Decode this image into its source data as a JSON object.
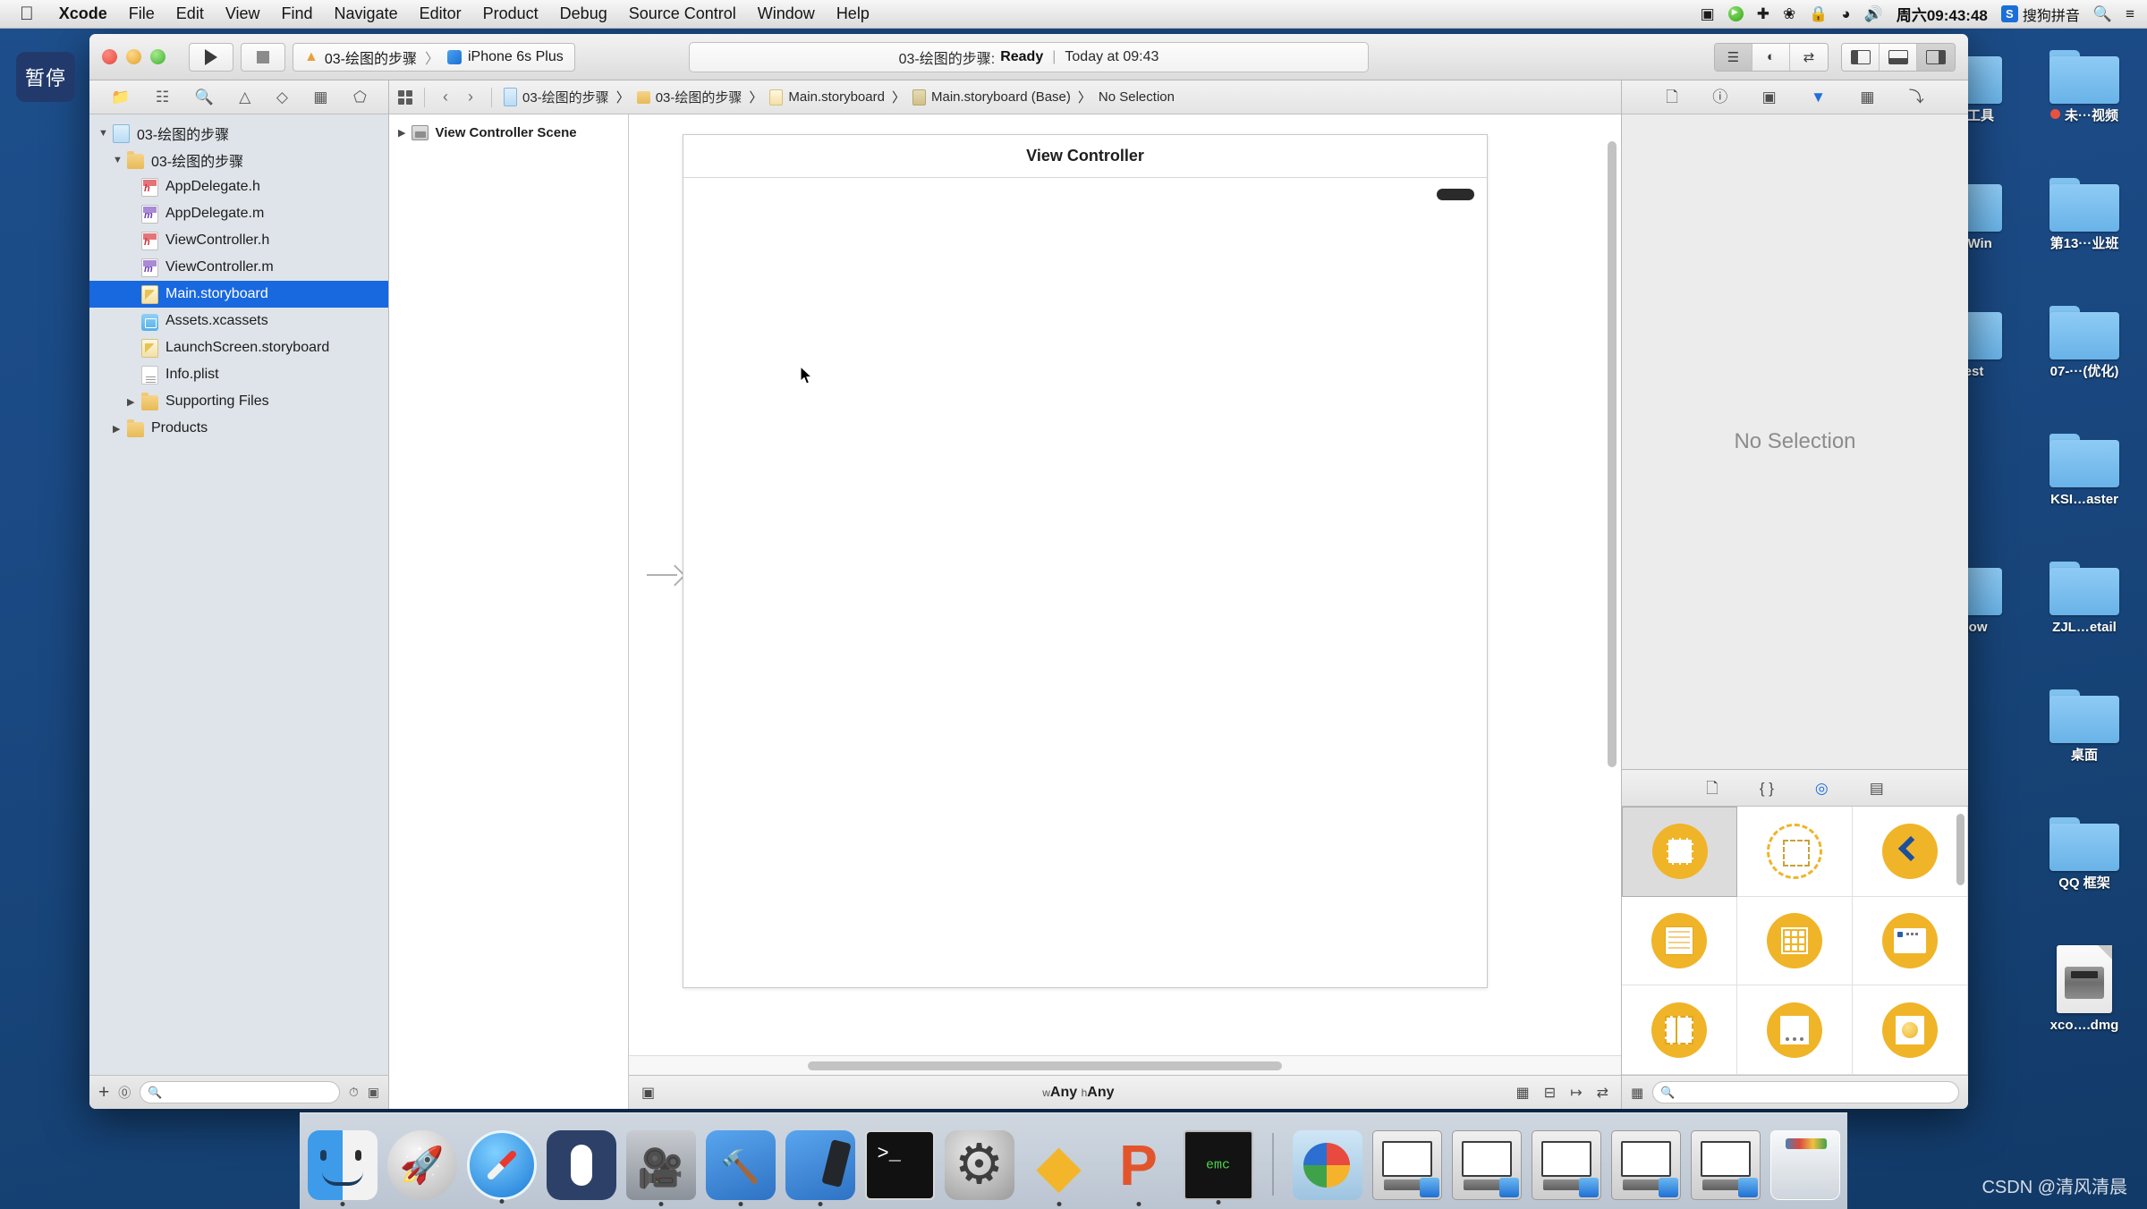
{
  "menubar": {
    "apple_icon": "apple-logo",
    "items": [
      {
        "label": "Xcode",
        "bold": true
      },
      {
        "label": "File",
        "bold": false
      },
      {
        "label": "Edit",
        "bold": false
      },
      {
        "label": "View",
        "bold": false
      },
      {
        "label": "Find",
        "bold": false
      },
      {
        "label": "Navigate",
        "bold": false
      },
      {
        "label": "Editor",
        "bold": false
      },
      {
        "label": "Product",
        "bold": false
      },
      {
        "label": "Debug",
        "bold": false
      },
      {
        "label": "Source Control",
        "bold": false
      },
      {
        "label": "Window",
        "bold": false
      },
      {
        "label": "Help",
        "bold": false
      }
    ],
    "status_icons": [
      "screen-record-icon",
      "play-green-icon",
      "airplane-icon",
      "bluetooth-icon",
      "lock-icon",
      "wifi-icon",
      "volume-icon"
    ],
    "clock": "周六09:43:48",
    "ime_badge": "S",
    "ime_label": "搜狗拼音",
    "search_icon": "search-icon",
    "control_center_icon": "list-icon"
  },
  "pause_badge": {
    "label": "暂停"
  },
  "toolbar": {
    "run_button": "run-button",
    "stop_button": "stop-button",
    "scheme_name": "03-绘图的步骤",
    "scheme_separator": "〉",
    "destination": "iPhone 6s Plus",
    "status_project": "03-绘图的步骤:",
    "status_state": "Ready",
    "status_divider": "|",
    "status_time": "Today at 09:43",
    "editor_segments": [
      "standard-editor-icon",
      "assistant-editor-icon",
      "version-editor-icon"
    ],
    "panel_toggles": [
      "navigator-toggle",
      "debug-toggle",
      "utilities-toggle"
    ]
  },
  "navigator": {
    "tabs": [
      {
        "name": "project-navigator",
        "icon": "folder-icon",
        "selected": true
      },
      {
        "name": "source-control-navigator",
        "icon": "branch-icon",
        "selected": false
      },
      {
        "name": "find-navigator",
        "icon": "search-icon",
        "selected": false
      },
      {
        "name": "issue-navigator",
        "icon": "warning-icon",
        "selected": false
      },
      {
        "name": "test-navigator",
        "icon": "diamond-icon",
        "selected": false
      },
      {
        "name": "debug-navigator",
        "icon": "debug-icon",
        "selected": false
      },
      {
        "name": "breakpoint-navigator",
        "icon": "tag-icon",
        "selected": false
      }
    ],
    "items": [
      {
        "label": "03-绘图的步骤",
        "indent": 0,
        "twisty": "▼",
        "icon": "project-icon",
        "selected": false
      },
      {
        "label": "03-绘图的步骤",
        "indent": 1,
        "twisty": "▼",
        "icon": "folder-icon",
        "selected": false
      },
      {
        "label": "AppDelegate.h",
        "indent": 2,
        "twisty": "",
        "icon": "header-file-icon",
        "selected": false
      },
      {
        "label": "AppDelegate.m",
        "indent": 2,
        "twisty": "",
        "icon": "objc-file-icon",
        "selected": false
      },
      {
        "label": "ViewController.h",
        "indent": 2,
        "twisty": "",
        "icon": "header-file-icon",
        "selected": false
      },
      {
        "label": "ViewController.m",
        "indent": 2,
        "twisty": "",
        "icon": "objc-file-icon",
        "selected": false
      },
      {
        "label": "Main.storyboard",
        "indent": 2,
        "twisty": "",
        "icon": "storyboard-icon",
        "selected": true
      },
      {
        "label": "Assets.xcassets",
        "indent": 2,
        "twisty": "",
        "icon": "xcassets-icon",
        "selected": false
      },
      {
        "label": "LaunchScreen.storyboard",
        "indent": 2,
        "twisty": "",
        "icon": "storyboard-icon",
        "selected": false
      },
      {
        "label": "Info.plist",
        "indent": 2,
        "twisty": "",
        "icon": "plist-icon",
        "selected": false
      },
      {
        "label": "Supporting Files",
        "indent": 1,
        "twisty": "▶",
        "icon": "folder-icon",
        "selected": false
      },
      {
        "label": "Products",
        "indent": 0,
        "twisty": "▶",
        "icon": "folder-icon",
        "selected": false
      }
    ],
    "footer": {
      "add_icon": "+",
      "filter_icon": "filter-icon",
      "filter_placeholder": "",
      "recent_icon": "clock-icon",
      "sourcecontrol_icon": "modified-icon"
    }
  },
  "jumpbar": {
    "related_icon": "related-items-icon",
    "back_icon": "‹",
    "forward_icon": "›",
    "crumbs": [
      {
        "label": "03-绘图的步骤",
        "icon": "project-icon"
      },
      {
        "label": "03-绘图的步骤",
        "icon": "folder-icon"
      },
      {
        "label": "Main.storyboard",
        "icon": "storyboard-icon"
      },
      {
        "label": "Main.storyboard (Base)",
        "icon": "storyboard-base-icon"
      },
      {
        "label": "No Selection",
        "icon": ""
      }
    ],
    "chevron": "〉"
  },
  "outline": {
    "twisty": "▶",
    "icon": "scene-icon",
    "label": "View Controller Scene"
  },
  "canvas": {
    "view_controller_title": "View Controller",
    "entry_arrow": "entry-point-arrow",
    "home_indicator": "home-indicator",
    "cursor": "mouse-cursor"
  },
  "canvas_footer": {
    "left_icon": "view-as-icon",
    "size_class_w_prefix": "w",
    "size_class_w": "Any",
    "size_class_h_prefix": "h",
    "size_class_h": "Any",
    "right_icons": [
      "variations-icon",
      "align-icon",
      "pin-icon",
      "resolve-issues-icon",
      "embed-icon"
    ]
  },
  "utilities": {
    "inspector_tabs": [
      {
        "name": "file-inspector",
        "icon": "document-icon",
        "selected": false
      },
      {
        "name": "quick-help-inspector",
        "icon": "help-icon",
        "selected": false
      },
      {
        "name": "identity-inspector-card",
        "icon": "id-card-icon",
        "selected": false
      },
      {
        "name": "attributes-inspector",
        "icon": "attributes-icon",
        "selected": true
      },
      {
        "name": "size-inspector",
        "icon": "ruler-icon",
        "selected": false
      },
      {
        "name": "connections-inspector",
        "icon": "connections-icon",
        "selected": false
      }
    ],
    "no_selection": "No Selection",
    "library_tabs": [
      {
        "name": "file-template-library",
        "icon": "document-icon",
        "selected": false
      },
      {
        "name": "code-snippet-library",
        "icon": "braces-icon",
        "selected": false
      },
      {
        "name": "object-library",
        "icon": "object-icon",
        "selected": true
      },
      {
        "name": "media-library",
        "icon": "media-icon",
        "selected": false
      }
    ],
    "objects": [
      {
        "name": "view-controller-object",
        "selected": true
      },
      {
        "name": "storyboard-reference-object",
        "selected": false
      },
      {
        "name": "navigation-controller-object",
        "selected": false
      },
      {
        "name": "table-view-controller-object",
        "selected": false
      },
      {
        "name": "collection-view-controller-object",
        "selected": false
      },
      {
        "name": "tab-bar-controller-object",
        "selected": false
      },
      {
        "name": "split-view-controller-object",
        "selected": false
      },
      {
        "name": "page-view-controller-object",
        "selected": false
      },
      {
        "name": "gl-kit-view-controller-object",
        "selected": false
      }
    ],
    "library_footer": {
      "grid_icon": "grid-view-icon",
      "search_placeholder": ""
    }
  },
  "desktop_icons": [
    {
      "label": "…发工具",
      "type": "folder",
      "dot": false
    },
    {
      "label": "未···视频",
      "type": "folder",
      "dot": true
    },
    {
      "label": "…stWin",
      "type": "folder",
      "dot": false
    },
    {
      "label": "第13···业班",
      "type": "folder",
      "dot": false
    },
    {
      "label": "…est",
      "type": "folder",
      "dot": false
    },
    {
      "label": "07-···(优化)",
      "type": "folder",
      "dot": false
    },
    {
      "label": "KSI…aster",
      "type": "folder",
      "dot": false
    },
    {
      "label": "…dow",
      "type": "folder",
      "dot": false
    },
    {
      "label": "ZJL…etail",
      "type": "folder",
      "dot": false
    },
    {
      "label": "桌面",
      "type": "folder",
      "dot": false
    },
    {
      "label": "QQ 框架",
      "type": "folder",
      "dot": false
    },
    {
      "label": "xco….dmg",
      "type": "dmg",
      "dot": false
    }
  ],
  "dock": {
    "apps": [
      {
        "name": "finder",
        "running": true
      },
      {
        "name": "launchpad",
        "running": false
      },
      {
        "name": "safari",
        "running": true
      },
      {
        "name": "mouse-app",
        "running": false
      },
      {
        "name": "quicktime-player",
        "running": true
      },
      {
        "name": "xcode",
        "running": true
      },
      {
        "name": "xcode-simulator",
        "running": true
      },
      {
        "name": "terminal",
        "running": false
      },
      {
        "name": "system-preferences",
        "running": false
      },
      {
        "name": "sketch",
        "running": true
      },
      {
        "name": "paw",
        "running": true
      },
      {
        "name": "emacs",
        "running": true
      }
    ],
    "minimized": [
      {
        "name": "stacks-folder"
      },
      {
        "name": "window-1"
      },
      {
        "name": "window-2"
      },
      {
        "name": "window-3"
      },
      {
        "name": "window-4"
      },
      {
        "name": "window-5"
      },
      {
        "name": "trash"
      }
    ]
  },
  "watermark": {
    "text": "CSDN @清风清晨"
  }
}
